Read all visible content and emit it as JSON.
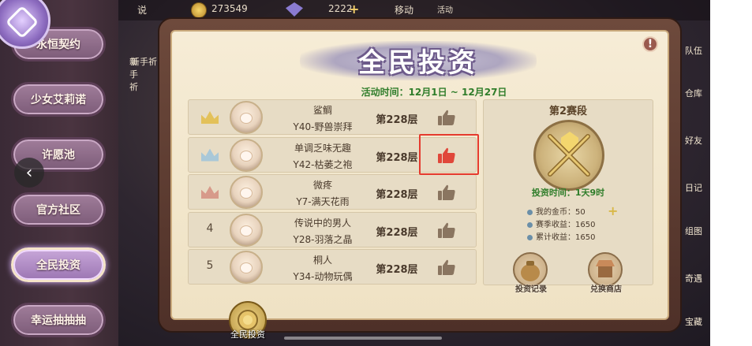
{
  "top_bar": {
    "left_text": "说",
    "gold": "273549",
    "gems": "2222",
    "move_label": "移动",
    "right_icon_label": "活动"
  },
  "sidebar": {
    "items": [
      {
        "label": "永恒契约"
      },
      {
        "label": "少女艾莉诺"
      },
      {
        "label": "许愿池"
      },
      {
        "label": "官方社区"
      },
      {
        "label": "全民投资",
        "active": true
      },
      {
        "label": "幸运抽抽抽"
      }
    ],
    "newbie_label": "新手祈"
  },
  "background_labels": {
    "right": [
      "队伍",
      "仓库",
      "好友",
      "日记",
      "组图",
      "奇遇",
      "宝藏"
    ]
  },
  "panel": {
    "title": "全民投资",
    "activity_time": "活动时间：12月1日 ~ 12月27日"
  },
  "ranking": [
    {
      "rank": "",
      "crown": "gold",
      "name": "鲨鲷",
      "guild": "Y40-野兽崇拜",
      "floor": "第228层",
      "liked": false
    },
    {
      "rank": "",
      "crown": "silver",
      "name": "单调乏味无趣",
      "guild": "Y42-枯萎之袍",
      "floor": "第228层",
      "liked": true
    },
    {
      "rank": "",
      "crown": "bronze",
      "name": "微疼",
      "guild": "Y7-满天花雨",
      "floor": "第228层",
      "liked": false
    },
    {
      "rank": "4",
      "crown": "",
      "name": "传说中的男人",
      "guild": "Y28-羽落之晶",
      "floor": "第228层",
      "liked": false
    },
    {
      "rank": "5",
      "crown": "",
      "name": "桐人",
      "guild": "Y34-动物玩偶",
      "floor": "第228层",
      "liked": false
    }
  ],
  "stage": {
    "title": "第2赛段",
    "invest_time": "投资时间：1天9时",
    "my_gold_label": "我的金币：50",
    "season_income_label": "赛季收益：1650",
    "total_income_label": "累计收益：1650",
    "record_label": "投资记录",
    "shop_label": "兑换商店"
  },
  "bottom_tab": {
    "label": "全民投资"
  },
  "colors": {
    "like_active": "#e0473a",
    "like_inactive": "#8a7560",
    "highlight_box": "#e53a2e",
    "green_text": "#2f7d2a",
    "crown_gold": "#e3c15a",
    "crown_silver": "#a9c8d8",
    "crown_bronze": "#d79a8a"
  },
  "icons": {
    "like": "thumbs-up-icon",
    "info": "exclamation-icon",
    "back": "chevron-left-icon",
    "add": "plus-icon",
    "coin": "coin-icon",
    "gem": "gem-icon"
  }
}
